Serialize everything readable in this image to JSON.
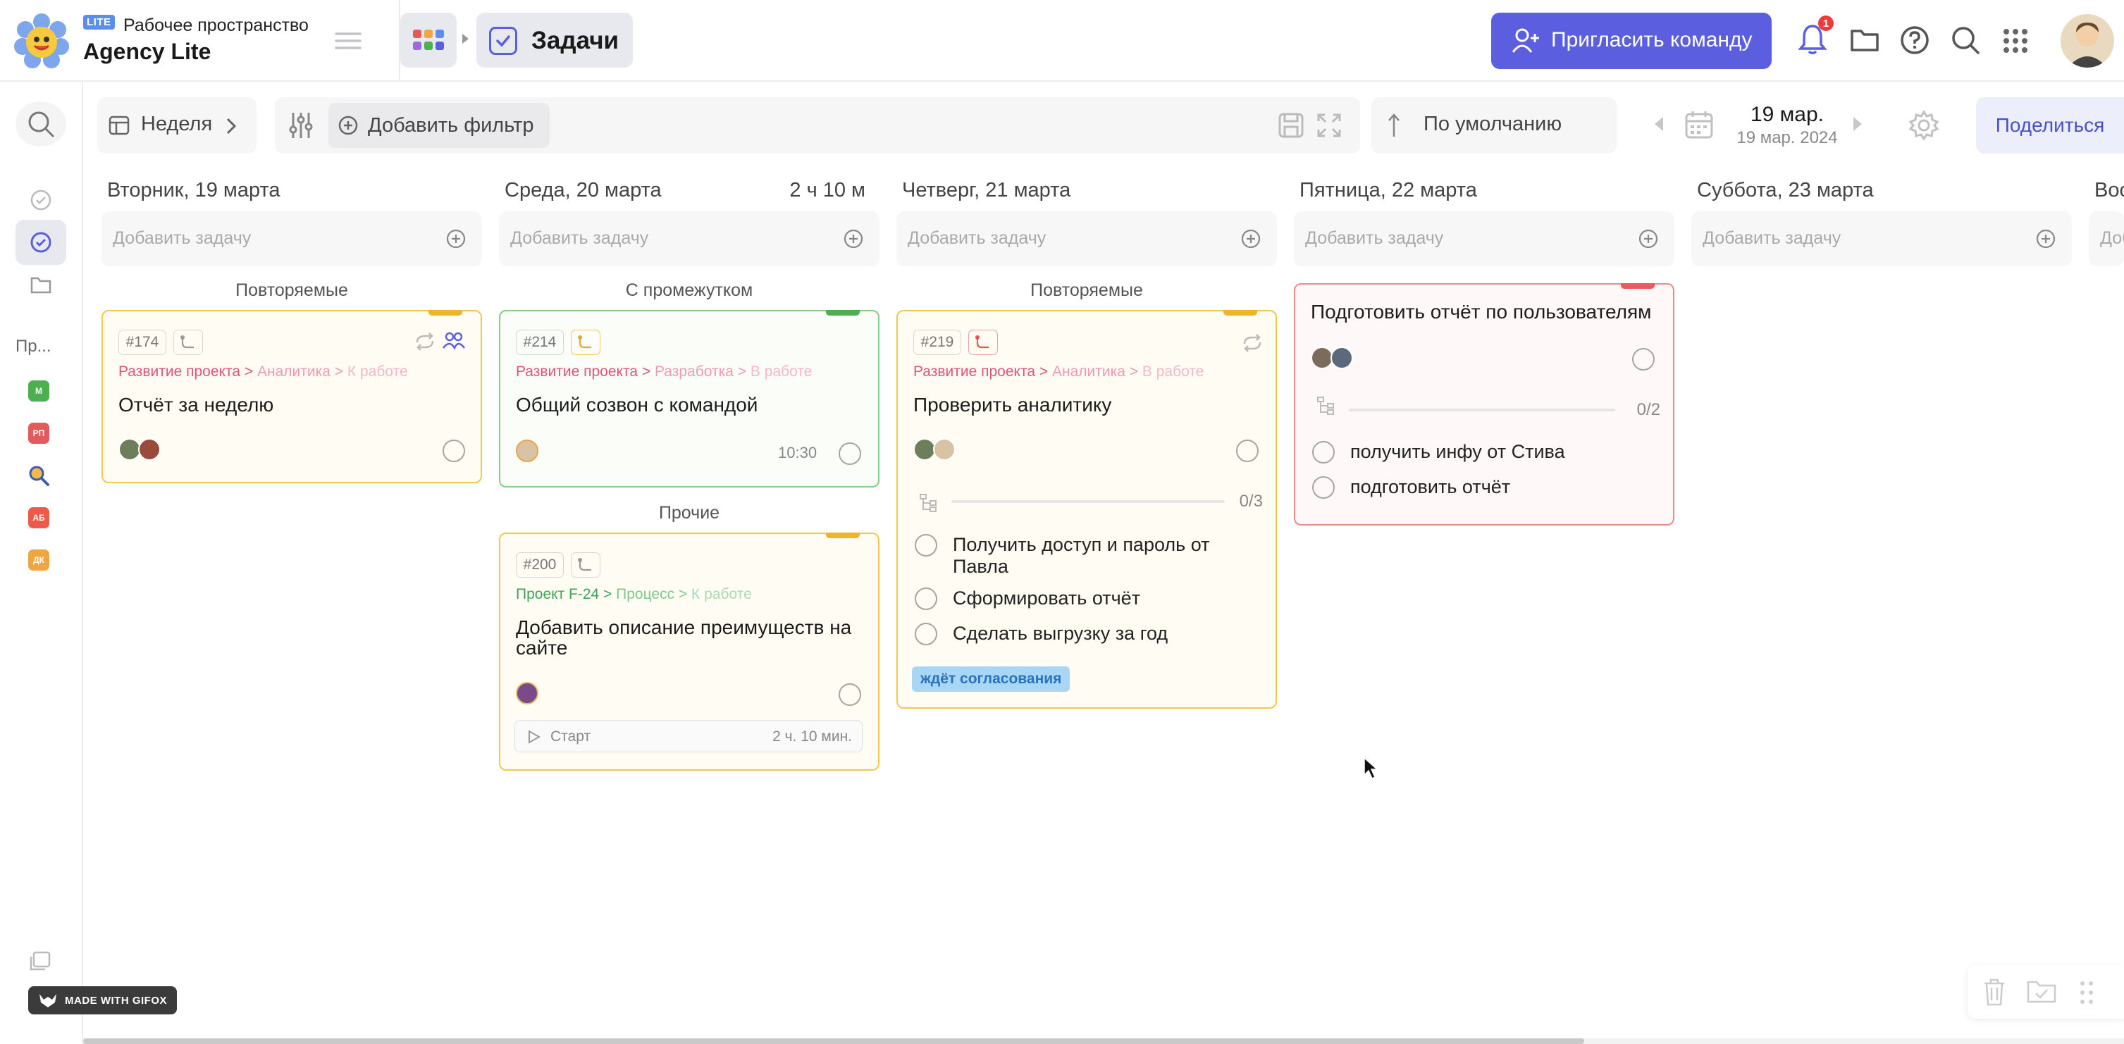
{
  "header": {
    "lite_badge": "LITE",
    "workspace_label": "Рабочее пространство",
    "workspace_name": "Agency Lite",
    "section_title": "Задачи",
    "invite_label": "Пригласить команду",
    "notif_count": "1"
  },
  "sidebar": {
    "projects_label": "Пр...",
    "projects": [
      {
        "abbr": "М",
        "color": "#4caf50"
      },
      {
        "abbr": "РП",
        "color": "#e35a5a"
      },
      {
        "abbr": "",
        "color": "#3b5bb5"
      },
      {
        "abbr": "АБ",
        "color": "#ee5a4a"
      },
      {
        "abbr": "ДК",
        "color": "#f0a640"
      }
    ]
  },
  "toolbar": {
    "view_label": "Неделя",
    "add_filter": "Добавить фильтр",
    "sort_label": "По умолчанию",
    "date_main": "19 мар.",
    "date_sub": "19 мар. 2024",
    "share_label": "Поделиться"
  },
  "add_task_placeholder": "Добавить задачу",
  "columns": [
    {
      "day": "Вторник, 19 марта",
      "duration": ""
    },
    {
      "day": "Среда, 20 марта",
      "duration": "2 ч 10 м"
    },
    {
      "day": "Четверг, 21 марта",
      "duration": ""
    },
    {
      "day": "Пятница, 22 марта",
      "duration": ""
    },
    {
      "day": "Суббота, 23 марта",
      "duration": ""
    },
    {
      "day": "Вос",
      "duration": ""
    }
  ],
  "groups": {
    "recurring": "Повторяемые",
    "with_interval": "С промежутком",
    "other": "Прочие"
  },
  "cards": {
    "c174": {
      "id": "#174",
      "crumb": [
        "Развитие проекта",
        ">",
        "Аналитика",
        ">",
        "К работе"
      ],
      "title": "Отчёт за неделю"
    },
    "c214": {
      "id": "#214",
      "crumb": [
        "Развитие проекта",
        ">",
        "Разработка",
        ">",
        "В работе"
      ],
      "title": "Общий созвон с командой",
      "time": "10:30"
    },
    "c200": {
      "id": "#200",
      "crumb": [
        "Проект F-24",
        ">",
        "Процесс",
        ">",
        "К работе"
      ],
      "title": "Добавить описание преимуществ на сайте",
      "start_label": "Старт",
      "timer": "2 ч. 10 мин."
    },
    "c219": {
      "id": "#219",
      "crumb": [
        "Развитие проекта",
        ">",
        "Аналитика",
        ">",
        "В работе"
      ],
      "title": "Проверить аналитику",
      "progress": "0/3",
      "subtasks": [
        "Получить доступ и пароль от Павла",
        "Сформировать отчёт",
        "Сделать выгрузку за год"
      ],
      "badge": "ждёт согласования"
    },
    "cfri": {
      "title": "Подготовить отчёт по пользователям",
      "progress": "0/2",
      "subtasks": [
        "получить инфу от Стива",
        "подготовить отчёт"
      ]
    }
  },
  "watermark": "MADE WITH GIFOX",
  "colors": {
    "accent": "#5b5fdf",
    "yellow_border": "#f2c94c",
    "green_border": "#7fcf87",
    "red_border": "#f08a8a",
    "crumb_red": "#e0537a",
    "crumb_green": "#3aa655",
    "badge_bg": "#a9d6f5",
    "badge_text": "#2873b9"
  }
}
